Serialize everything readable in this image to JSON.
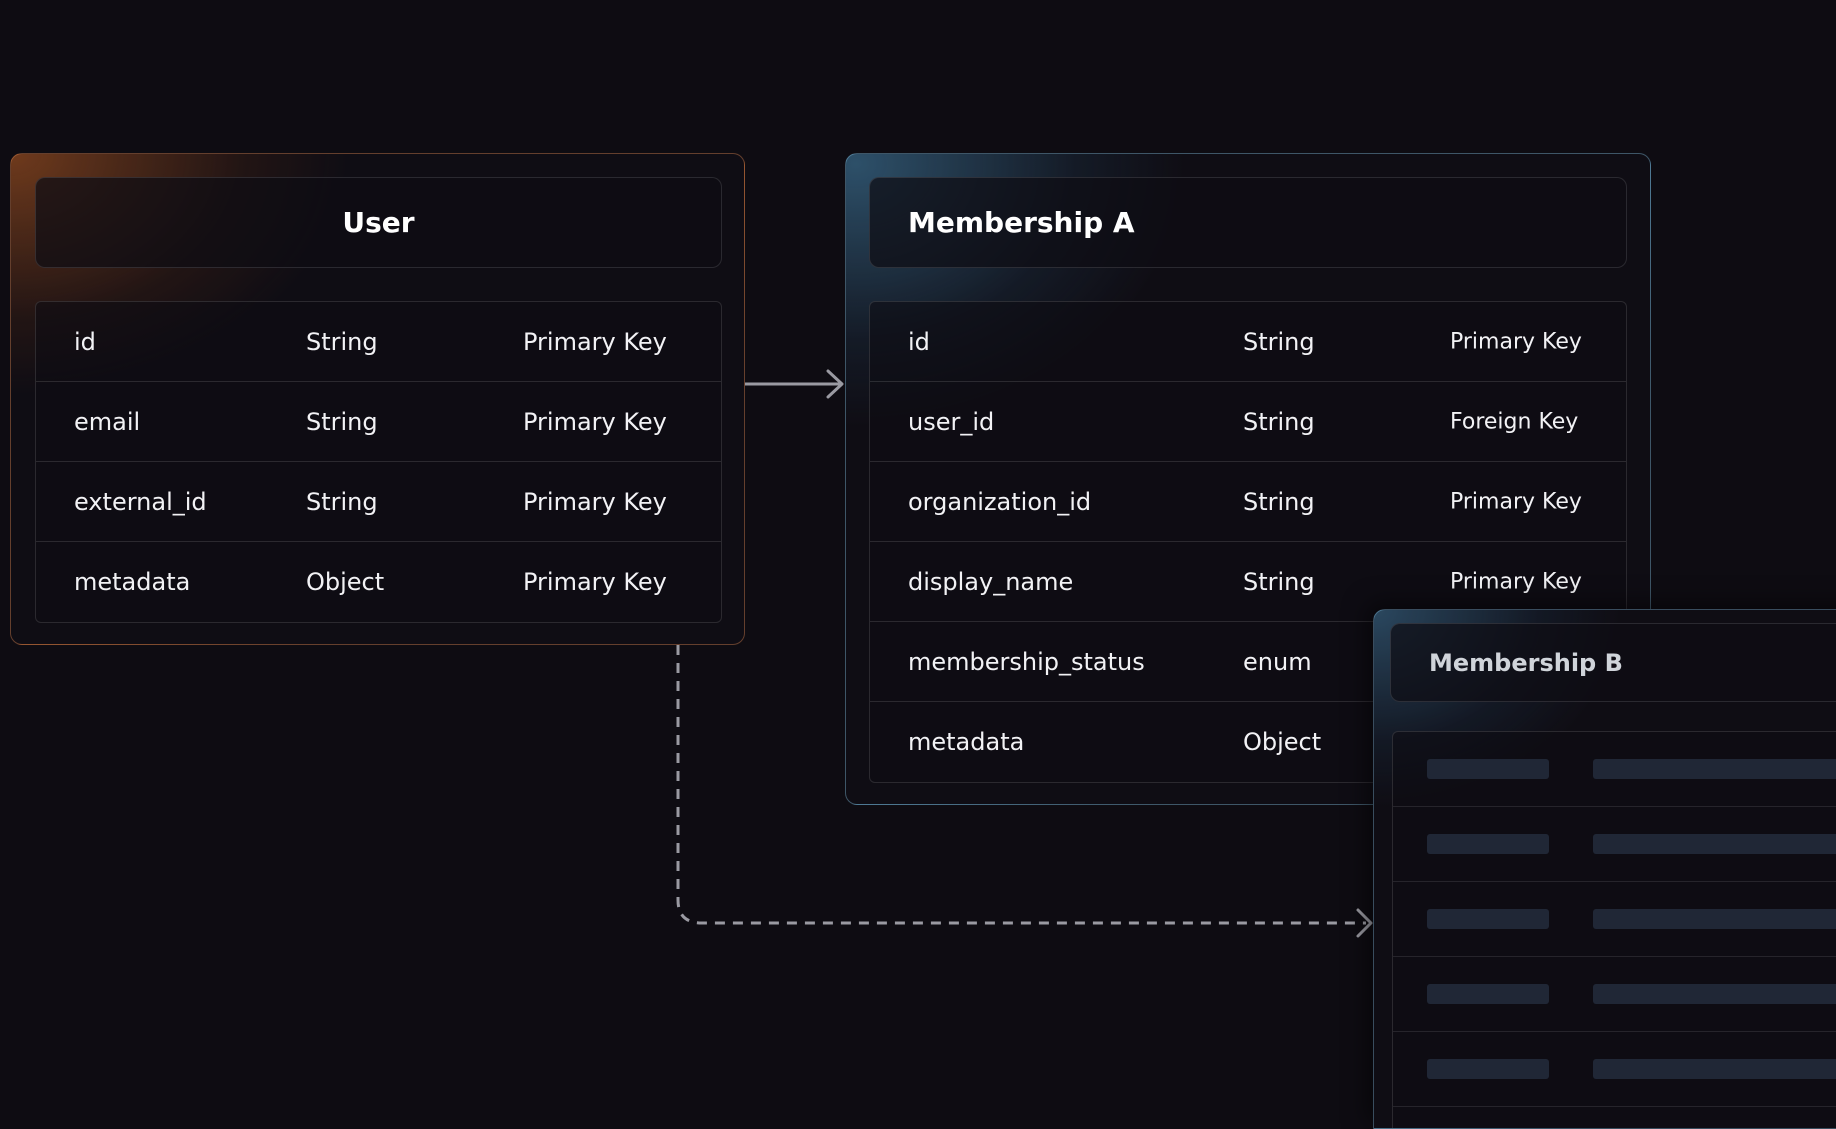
{
  "user_table": {
    "title": "User",
    "rows": [
      {
        "field": "id",
        "type": "String",
        "key": "Primary Key"
      },
      {
        "field": "email",
        "type": "String",
        "key": "Primary Key"
      },
      {
        "field": "external_id",
        "type": "String",
        "key": "Primary Key"
      },
      {
        "field": "metadata",
        "type": "Object",
        "key": "Primary Key"
      }
    ]
  },
  "membership_a_table": {
    "title": "Membership A",
    "rows": [
      {
        "field": "id",
        "type": "String",
        "key": "Primary Key"
      },
      {
        "field": "user_id",
        "type": "String",
        "key": "Foreign Key"
      },
      {
        "field": "organization_id",
        "type": "String",
        "key": "Primary Key"
      },
      {
        "field": "display_name",
        "type": "String",
        "key": "Primary Key"
      },
      {
        "field": "membership_status",
        "type": "enum",
        "key": ""
      },
      {
        "field": "metadata",
        "type": "Object",
        "key": ""
      }
    ]
  },
  "membership_b_table": {
    "title": "Membership B",
    "placeholder_row_count": 5
  },
  "colors": {
    "background": "#0e0c12",
    "user_accent": "#be5f23",
    "membership_accent": "#4687af",
    "connector": "#9a9aa2",
    "placeholder": "#202736"
  }
}
